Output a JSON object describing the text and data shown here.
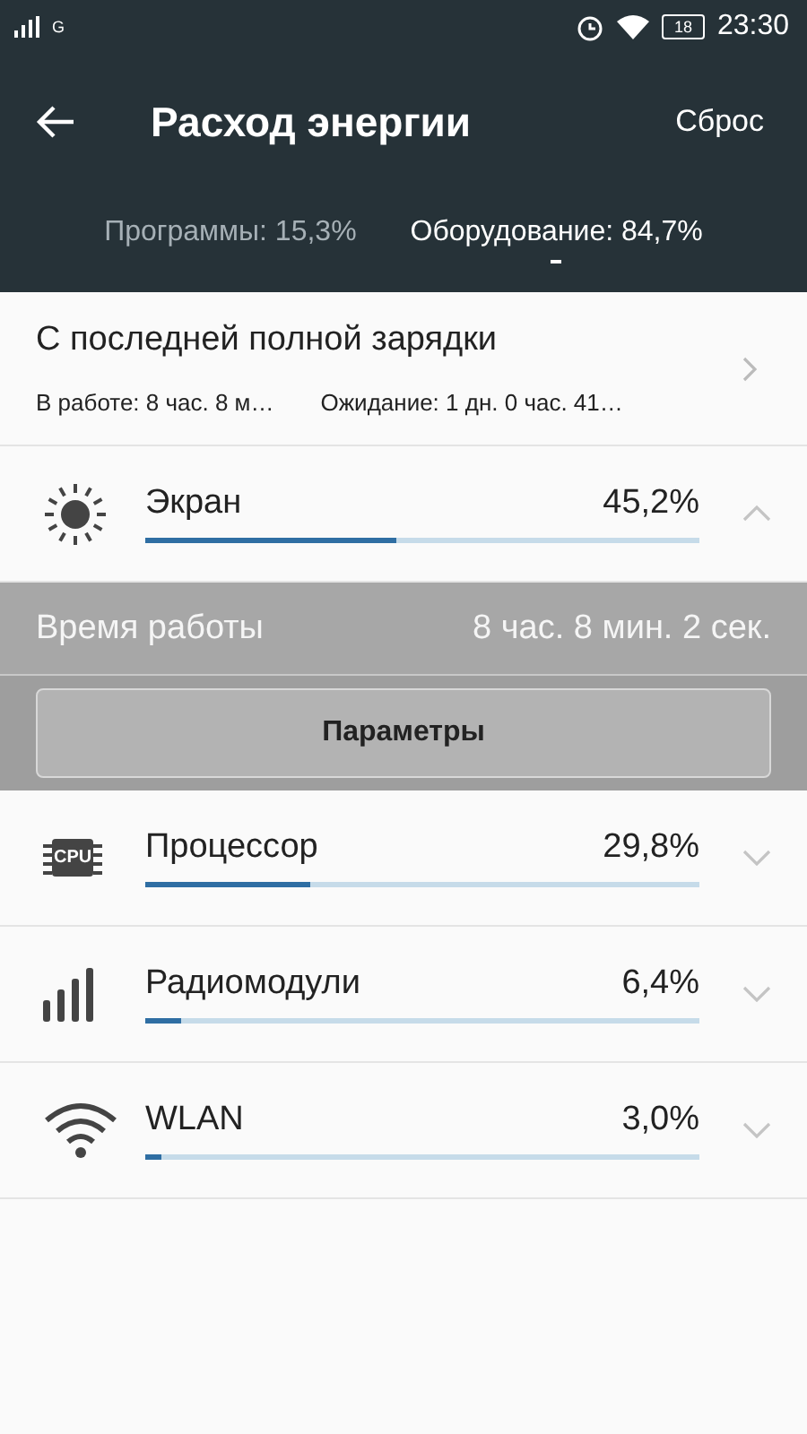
{
  "status_bar": {
    "network": "G",
    "battery": "18",
    "time": "23:30"
  },
  "header": {
    "title": "Расход энергии",
    "action": "Сброс"
  },
  "tabs": [
    {
      "label": "Программы: 15,3%",
      "selected": false
    },
    {
      "label": "Оборудование: 84,7%",
      "selected": true
    }
  ],
  "summary": {
    "title": "С последней полной зарядки",
    "active": "В работе: 8 час. 8 м…",
    "standby": "Ожидание: 1 дн. 0 час. 41…"
  },
  "items": [
    {
      "kind": "screen",
      "name": "Экран",
      "value": "45,2%",
      "level": 0.452,
      "expanded": true,
      "details": {
        "label": "Время работы",
        "value": "8 час. 8 мин. 2 сек.",
        "button": "Параметры"
      }
    },
    {
      "kind": "cpu",
      "icon_text": "CPU",
      "name": "Процессор",
      "value": "29,8%",
      "level": 0.298,
      "expanded": false
    },
    {
      "kind": "radio",
      "name": "Радиомодули",
      "value": "6,4%",
      "level": 0.064,
      "expanded": false
    },
    {
      "kind": "wifi",
      "name": "WLAN",
      "value": "3,0%",
      "level": 0.03,
      "expanded": false
    }
  ]
}
